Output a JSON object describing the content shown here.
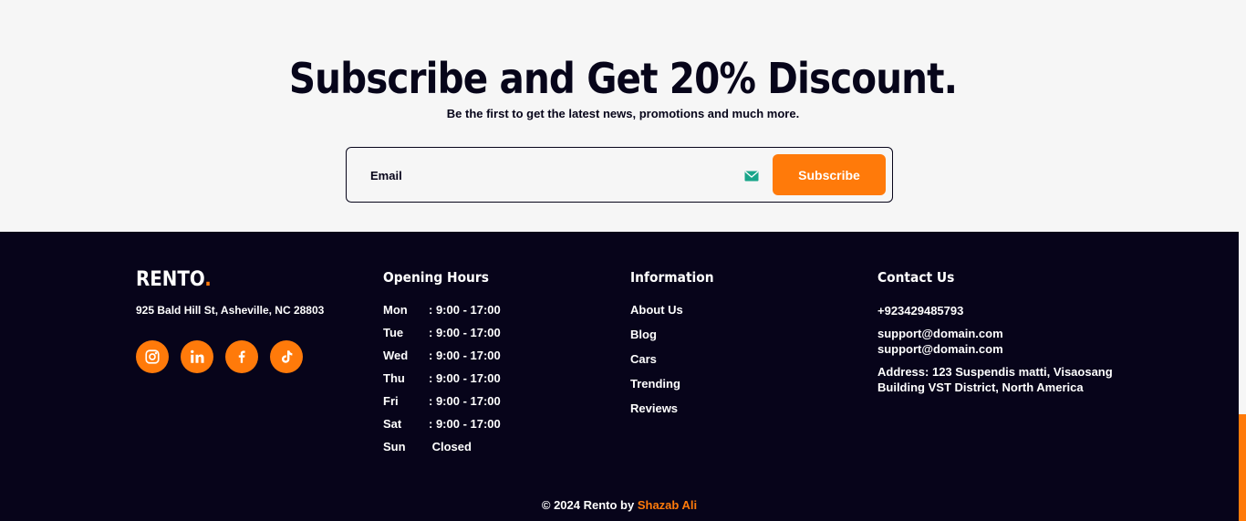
{
  "subscribe": {
    "title": "Subscribe and Get 20% Discount.",
    "subtitle": "Be the first to get the latest news, promotions and much more.",
    "email_placeholder": "Email",
    "button_label": "Subscribe",
    "icon": "mail-icon"
  },
  "brand": {
    "logo_text": "RENTO",
    "logo_dot": ".",
    "address": "925 Bald Hill St, Asheville, NC 28803",
    "socials": [
      "instagram-icon",
      "linkedin-icon",
      "facebook-icon",
      "tiktok-icon"
    ]
  },
  "hours": {
    "title": "Opening Hours",
    "rows": [
      {
        "day": "Mon",
        "time": ": 9:00 - 17:00"
      },
      {
        "day": "Tue",
        "time": ": 9:00 - 17:00"
      },
      {
        "day": "Wed",
        "time": ": 9:00 - 17:00"
      },
      {
        "day": "Thu",
        "time": ": 9:00 - 17:00"
      },
      {
        "day": "Fri",
        "time": ": 9:00 - 17:00"
      },
      {
        "day": "Sat",
        "time": ": 9:00 - 17:00"
      },
      {
        "day": "Sun",
        "time": " Closed"
      }
    ]
  },
  "info": {
    "title": "Information",
    "links": [
      "About Us",
      "Blog",
      "Cars",
      "Trending",
      "Reviews"
    ]
  },
  "contact": {
    "title": "Contact Us",
    "phone": "+923429485793",
    "email1": "support@domain.com",
    "email2": "support@domain.com",
    "address_line1": "Address: 123 Suspendis matti, Visaosang",
    "address_line2": "Building VST District, North America"
  },
  "footer": {
    "copyright": "© 2024 Rento by ",
    "author": "Shazab Ali"
  },
  "colors": {
    "accent": "#ff7a0a",
    "dark": "#07041a",
    "light_bg": "#f6f6f6"
  }
}
